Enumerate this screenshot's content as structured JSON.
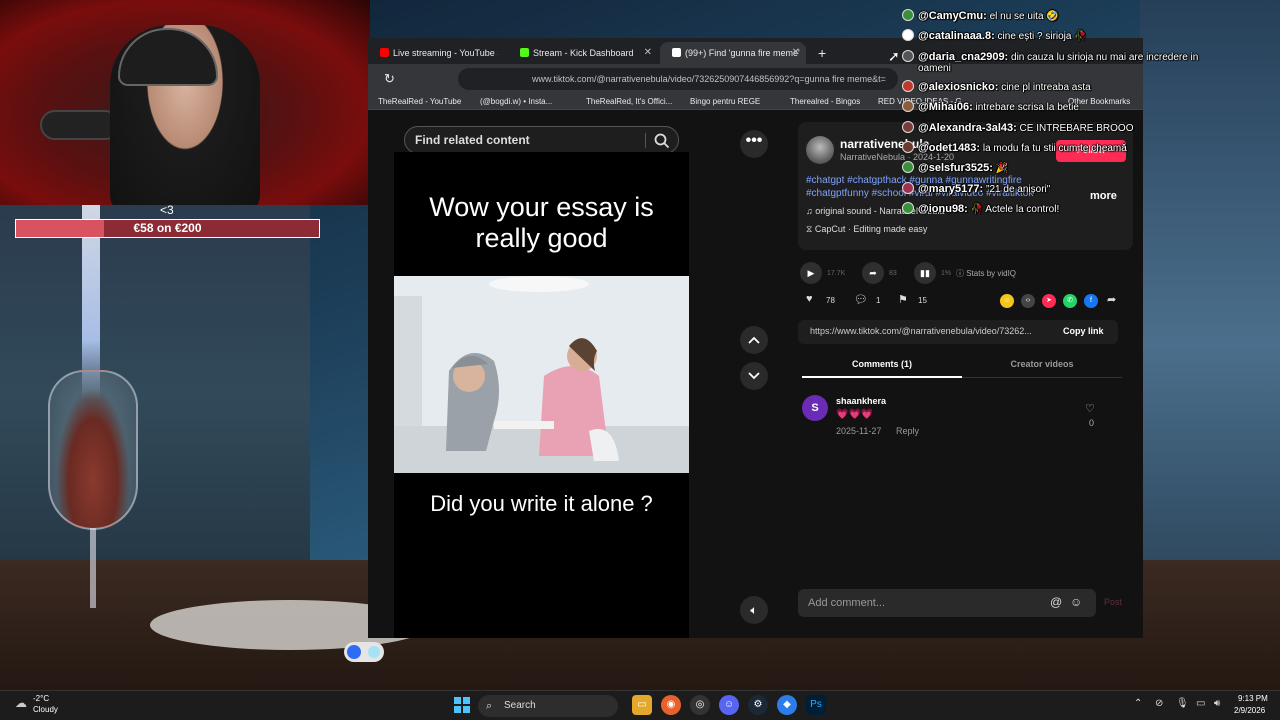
{
  "stream_overlay": {
    "goal_heart": "<3",
    "goal_text": "€58 on €200",
    "goal_progress_fraction": 0.29
  },
  "browser": {
    "tabs": [
      {
        "label": "Live streaming - YouTube Studio",
        "icon_color": "#ff0000"
      },
      {
        "label": "Stream - Kick Dashboard",
        "icon_color": "#53fc18"
      },
      {
        "label": "(99+) Find 'gunna fire meme'",
        "icon_color": "#ffffff",
        "active": true
      }
    ],
    "new_tab": "+",
    "address_url": "www.tiktok.com/@narrativenebula/video/7326250907446856992?q=gunna fire meme&t=",
    "bookmarks": [
      "TheRealRed - YouTube",
      "(@bogdi.w) • Insta...",
      "TheRealRed, It's Offici...",
      "Bingo pentru REGE",
      "Therealred - Bingos",
      "RED VIDEO IDEAS - G...",
      "Other Bookmarks"
    ]
  },
  "tiktok": {
    "search_placeholder": "Find related content",
    "video": {
      "top_caption": "Wow your essay is really good",
      "bottom_caption": "Did you write it alone ?"
    },
    "more_label": "•••",
    "author": {
      "name": "narrativenebula",
      "sub": "NarrativeNebula · 2024-1-20",
      "follow": "Follow"
    },
    "hashtags": "#chatgpt #chatgpthack #gunna #gunnawritingfire #chatgptfunny #school #viral #viralvideo #viraltiktok",
    "more_link": "more",
    "sound": "original sound - NarrativeNebula",
    "capcut": "CapCut · Editing made easy",
    "stats": {
      "plays": "17.7K",
      "shares_small": "83",
      "pct": "1%",
      "vidiq": "Stats by vidIQ"
    },
    "actions": {
      "likes": "78",
      "comments": "1",
      "saves": "15"
    },
    "link": {
      "url": "https://www.tiktok.com/@narrativenebula/video/73262...",
      "copy": "Copy link"
    },
    "tabs": {
      "comments": "Comments (1)",
      "creator": "Creator videos"
    },
    "comment": {
      "avatar_letter": "S",
      "user": "shaankhera",
      "text": "💗💗💗",
      "date": "2025-11-27",
      "reply": "Reply",
      "likes": "0"
    },
    "comment_input_placeholder": "Add comment...",
    "post": "Post"
  },
  "chat": [
    {
      "user": "@CamyCmu:",
      "text": " el nu se uita 🤣"
    },
    {
      "user": "@catalinaaa.8:",
      "text": " cine ești ? sirioja 🥀"
    },
    {
      "user": "@daria_cna2909:",
      "text": " din cauza lu sirioja nu mai are incredere in"
    },
    {
      "user": "",
      "text": "oameni"
    },
    {
      "user": "@alexiosnicko:",
      "text": " cine pl intreaba asta"
    },
    {
      "user": "@Mihai06:",
      "text": " intrebare scrisa la betie"
    },
    {
      "user": "@Alexandra-3al43:",
      "text": " CE INTREBARE BROOO"
    },
    {
      "user": "@odet1483:",
      "text": " la modu fa tu stii cum te cheamă"
    },
    {
      "user": "@selsfur3525:",
      "text": " 🎉"
    },
    {
      "user": "@mary5177:",
      "text": " \"21 de anișori\""
    },
    {
      "user": "@ionu98:",
      "text": " 🥀 Actele la control!"
    }
  ],
  "taskbar": {
    "temp": "-2°C",
    "weather": "Cloudy",
    "search": "Search",
    "time": "9:13 PM",
    "date": "2/9/2026"
  }
}
